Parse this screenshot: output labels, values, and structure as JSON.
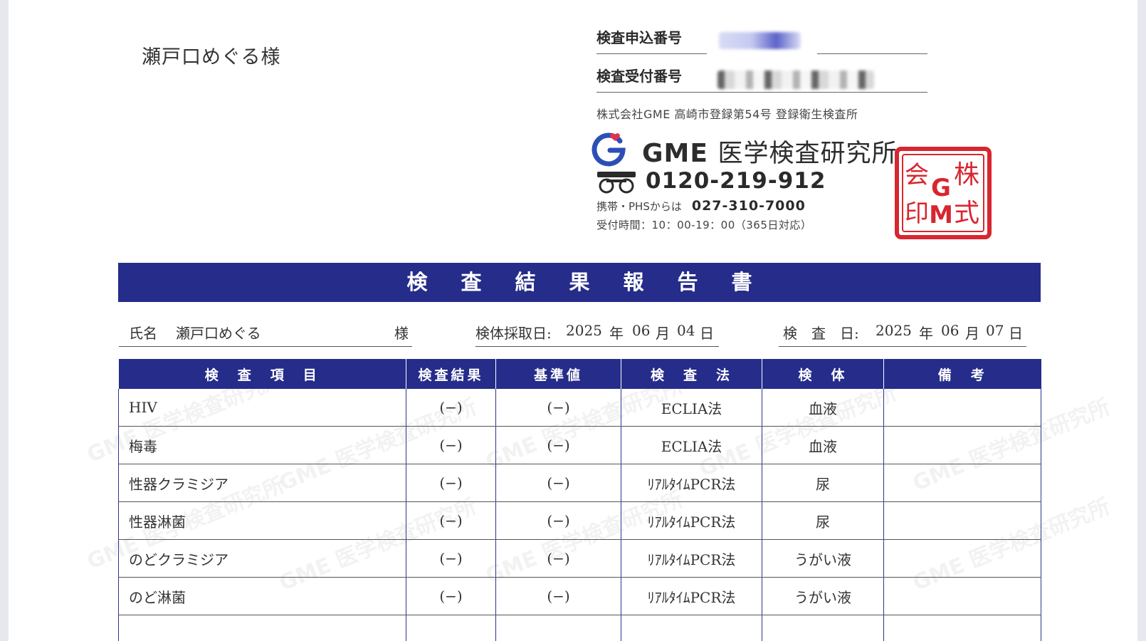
{
  "addressee": "瀬戸口めぐる様",
  "reference": {
    "application_label": "検査申込番号",
    "receipt_label": "検査受付番号"
  },
  "company": {
    "registration": "株式会社GME 高崎市登録第54号 登録衛生検査所",
    "logo_brand": "GME",
    "logo_lab": "医学検査研究所",
    "toll_free": "0120-219-912",
    "mobile_label": "携帯・PHSからは",
    "mobile_number": "027-310-7000",
    "hours": "受付時間：10：00-19：00（365日対応）",
    "seal_text": "株式会社GME医学検査研究所印"
  },
  "report_title": "検査結果報告書",
  "info": {
    "name_label": "氏名",
    "name_value": "瀬戸口めぐる",
    "name_suffix": "様",
    "sample_label": "検体採取日:",
    "sample_year": "2025",
    "sample_month": "06",
    "sample_day": "04",
    "test_label": "検　査　日:",
    "test_year": "2025",
    "test_month": "06",
    "test_day": "07",
    "year_unit": "年",
    "month_unit": "月",
    "day_unit": "日"
  },
  "table": {
    "headers": [
      "検　査　項　目",
      "検査結果",
      "基準値",
      "検　査　法",
      "検　体",
      "備　考"
    ],
    "rows": [
      {
        "item": "HIV",
        "result": "(−)",
        "reference": "(−)",
        "method": "ECLIA法",
        "specimen": "血液",
        "remarks": ""
      },
      {
        "item": "梅毒",
        "result": "(−)",
        "reference": "(−)",
        "method": "ECLIA法",
        "specimen": "血液",
        "remarks": ""
      },
      {
        "item": "性器クラミジア",
        "result": "(−)",
        "reference": "(−)",
        "method": "ﾘｱﾙﾀｲﾑPCR法",
        "specimen": "尿",
        "remarks": ""
      },
      {
        "item": "性器淋菌",
        "result": "(−)",
        "reference": "(−)",
        "method": "ﾘｱﾙﾀｲﾑPCR法",
        "specimen": "尿",
        "remarks": ""
      },
      {
        "item": "のどクラミジア",
        "result": "(−)",
        "reference": "(−)",
        "method": "ﾘｱﾙﾀｲﾑPCR法",
        "specimen": "うがい液",
        "remarks": ""
      },
      {
        "item": "のど淋菌",
        "result": "(−)",
        "reference": "(−)",
        "method": "ﾘｱﾙﾀｲﾑPCR法",
        "specimen": "うがい液",
        "remarks": ""
      },
      {
        "item": "",
        "result": "",
        "reference": "",
        "method": "",
        "specimen": "",
        "remarks": ""
      }
    ]
  },
  "watermark": "GME 医学検査研究所",
  "colors": {
    "band": "#252c8a",
    "seal": "#d8262f",
    "logo_blue": "#2b4fb5",
    "logo_red": "#e0334f"
  }
}
